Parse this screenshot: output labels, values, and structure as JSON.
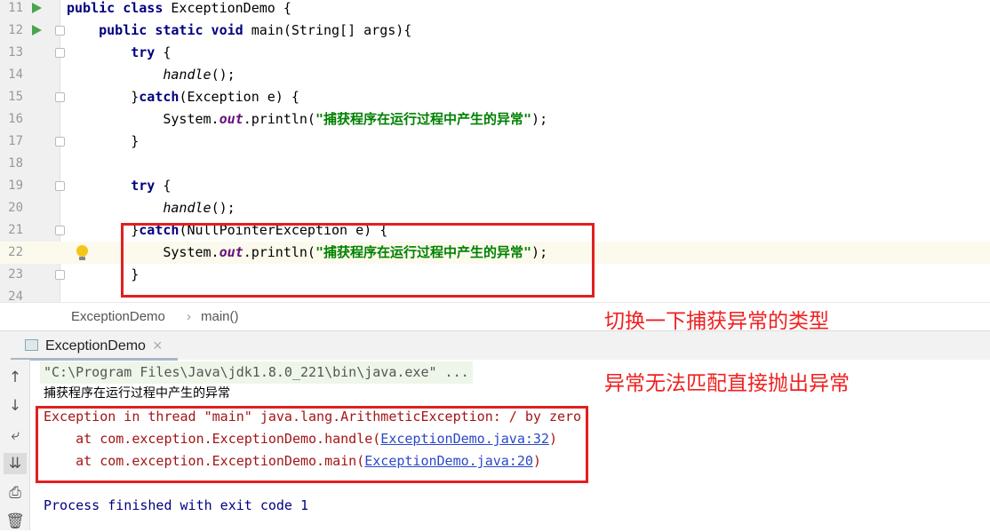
{
  "editor": {
    "lines": [
      {
        "n": "11",
        "run": true,
        "fold": false,
        "tokens": [
          [
            "kw",
            "public class "
          ],
          [
            "",
            "ExceptionDemo {"
          ]
        ]
      },
      {
        "n": "12",
        "run": true,
        "fold": true,
        "tokens": [
          [
            "",
            "    "
          ],
          [
            "kw",
            "public static void "
          ],
          [
            "",
            "main(String[] args){"
          ]
        ]
      },
      {
        "n": "13",
        "fold": true,
        "tokens": [
          [
            "",
            "        "
          ],
          [
            "kw",
            "try "
          ],
          [
            "",
            "{"
          ]
        ]
      },
      {
        "n": "14",
        "tokens": [
          [
            "",
            "            "
          ],
          [
            "it",
            "handle"
          ],
          [
            "",
            "();"
          ]
        ]
      },
      {
        "n": "15",
        "fold": true,
        "tokens": [
          [
            "",
            "        }"
          ],
          [
            "kw",
            "catch"
          ],
          [
            "",
            "(Exception e) {"
          ]
        ]
      },
      {
        "n": "16",
        "tokens": [
          [
            "",
            "            System."
          ],
          [
            "fld",
            "out"
          ],
          [
            "",
            ".println("
          ],
          [
            "str",
            "\"捕获程序在运行过程中产生的异常\""
          ],
          [
            "",
            ");"
          ]
        ]
      },
      {
        "n": "17",
        "fold": true,
        "tokens": [
          [
            "",
            "        }"
          ]
        ]
      },
      {
        "n": "18",
        "tokens": []
      },
      {
        "n": "19",
        "fold": true,
        "tokens": [
          [
            "",
            "        "
          ],
          [
            "kw",
            "try "
          ],
          [
            "",
            "{"
          ]
        ]
      },
      {
        "n": "20",
        "tokens": [
          [
            "",
            "            "
          ],
          [
            "it",
            "handle"
          ],
          [
            "",
            "();"
          ]
        ]
      },
      {
        "n": "21",
        "fold": true,
        "tokens": [
          [
            "",
            "        }"
          ],
          [
            "kw",
            "catch"
          ],
          [
            "",
            "(NullPointerException e) {"
          ]
        ]
      },
      {
        "n": "22",
        "hl": true,
        "bulb": true,
        "tokens": [
          [
            "",
            "            System."
          ],
          [
            "fld",
            "out"
          ],
          [
            "",
            ".println("
          ],
          [
            "str",
            "\"捕获程序在运行过程中产生的异常\""
          ],
          [
            "",
            ");"
          ]
        ]
      },
      {
        "n": "23",
        "fold": true,
        "tokens": [
          [
            "",
            "        }"
          ]
        ]
      },
      {
        "n": "24",
        "tokens": []
      }
    ]
  },
  "breadcrumb": {
    "class": "ExceptionDemo",
    "sep": "›",
    "method": "main()"
  },
  "run_tab": {
    "label": "ExceptionDemo",
    "close": "×"
  },
  "console": {
    "cmd": "\"C:\\Program Files\\Java\\jdk1.8.0_221\\bin\\java.exe\" ...",
    "out": "捕获程序在运行过程中产生的异常",
    "err": "Exception in thread \"main\" java.lang.ArithmeticException: / by zero",
    "trace": [
      {
        "pre": "    at com.exception.ExceptionDemo.handle(",
        "link": "ExceptionDemo.java:32",
        "post": ")"
      },
      {
        "pre": "    at com.exception.ExceptionDemo.main(",
        "link": "ExceptionDemo.java:20",
        "post": ")"
      }
    ],
    "exit": "Process finished with exit code 1"
  },
  "annotations": {
    "a1": "切换一下捕获异常的类型",
    "a2": "异常无法匹配直接抛出异常"
  },
  "colors": {
    "annotation": "#f02020",
    "error": "#a31515",
    "link": "#2a48c8"
  }
}
